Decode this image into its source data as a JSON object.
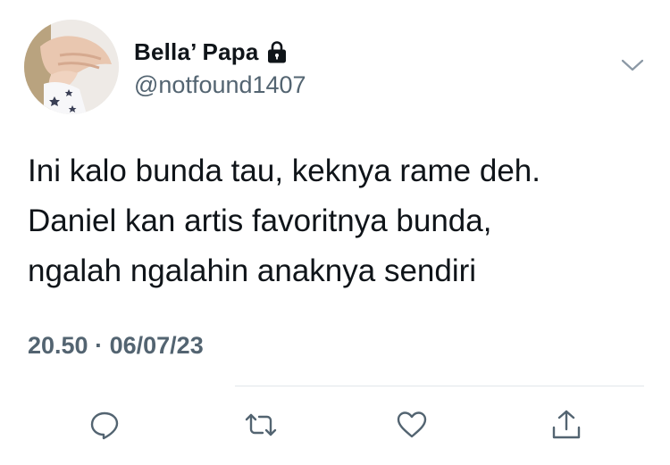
{
  "author": {
    "display_name": "Bella’ Papa",
    "handle": "@notfound1407",
    "protected_icon": "lock-icon",
    "avatar": "avatar-photo"
  },
  "menu": {
    "icon": "chevron-down-icon"
  },
  "tweet": {
    "lines": [
      "Ini kalo bunda tau, keknya rame deh.",
      "Daniel kan artis favoritnya bunda,",
      "ngalah ngalahin anaknya sendiri"
    ],
    "time": "20.50",
    "separator": "·",
    "date": "06/07/23"
  },
  "actions": [
    {
      "icon": "reply-icon"
    },
    {
      "icon": "retweet-icon"
    },
    {
      "icon": "like-icon"
    },
    {
      "icon": "share-icon"
    }
  ],
  "colors": {
    "text": "#0f1419",
    "secondary": "#536471",
    "divider": "#e1e6ea"
  }
}
